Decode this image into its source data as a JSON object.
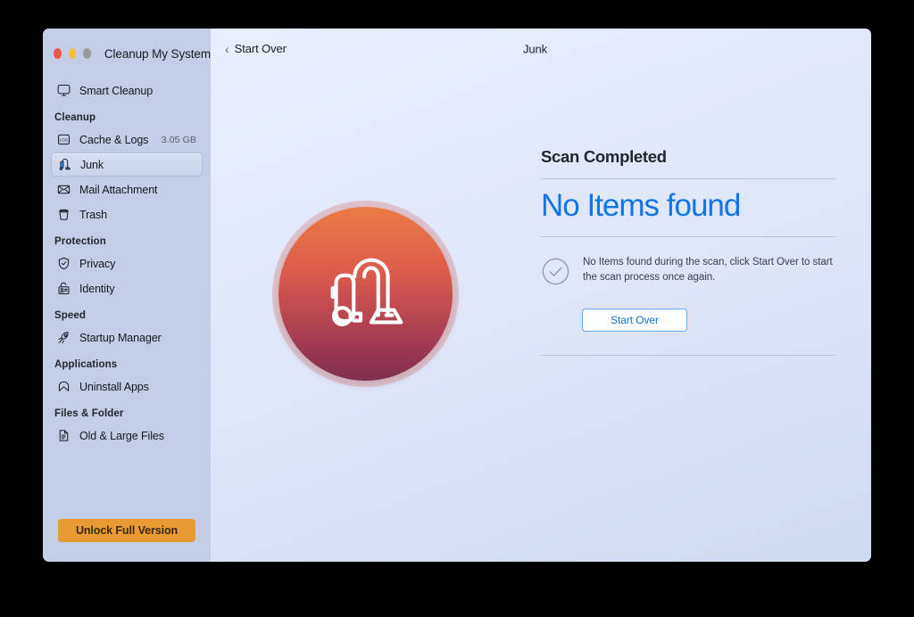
{
  "window": {
    "app_title": "Cleanup My System",
    "traffic_lights": [
      "close-red",
      "minimize-yellow",
      "zoom-gray"
    ]
  },
  "sidebar": {
    "top_item": {
      "label": "Smart Cleanup",
      "icon": "monitor-icon"
    },
    "groups": [
      {
        "header": "Cleanup",
        "items": [
          {
            "label": "Cache & Logs",
            "icon": "log-file-icon",
            "size": "3.05 GB",
            "selected": false
          },
          {
            "label": "Junk",
            "icon": "vacuum-icon",
            "size": "",
            "selected": true
          },
          {
            "label": "Mail Attachment",
            "icon": "envelope-icon",
            "size": "",
            "selected": false
          },
          {
            "label": "Trash",
            "icon": "trash-icon",
            "size": "",
            "selected": false
          }
        ]
      },
      {
        "header": "Protection",
        "items": [
          {
            "label": "Privacy",
            "icon": "shield-check-icon",
            "size": "",
            "selected": false
          },
          {
            "label": "Identity",
            "icon": "id-lock-icon",
            "size": "",
            "selected": false
          }
        ]
      },
      {
        "header": "Speed",
        "items": [
          {
            "label": "Startup Manager",
            "icon": "rocket-icon",
            "size": "",
            "selected": false
          }
        ]
      },
      {
        "header": "Applications",
        "items": [
          {
            "label": "Uninstall Apps",
            "icon": "arch-app-icon",
            "size": "",
            "selected": false
          }
        ]
      },
      {
        "header": "Files & Folder",
        "items": [
          {
            "label": "Old & Large Files",
            "icon": "document-icon",
            "size": "",
            "selected": false
          }
        ]
      }
    ],
    "unlock_button": "Unlock Full Version"
  },
  "toolbar": {
    "back_label": "Start Over",
    "back_icon": "chevron-left-icon",
    "title": "Junk"
  },
  "main": {
    "badge_icon": "vacuum-cleaner-illustration",
    "scan_status": "Scan Completed",
    "result": "No Items found",
    "status_icon": "check-circle-icon",
    "description": "No Items found during the scan, click Start Over to start the scan process once again.",
    "start_over_button": "Start Over"
  },
  "colors": {
    "accent_blue": "#1274e8",
    "unlock_orange": "#e89b33",
    "sidebar_bg": "#c3cee6",
    "badge_gradient_top": "#ea7b45",
    "badge_gradient_bottom": "#7e2f50"
  }
}
